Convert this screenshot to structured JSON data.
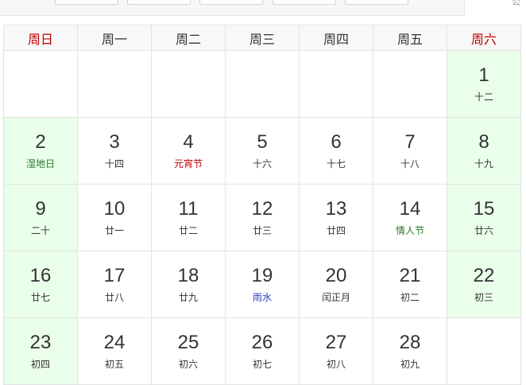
{
  "header": {
    "clipped_text": "公"
  },
  "weekdays": [
    "周日",
    "周一",
    "周二",
    "周三",
    "周四",
    "周五",
    "周六"
  ],
  "weeks": [
    [
      {
        "empty": true
      },
      {
        "empty": true
      },
      {
        "empty": true
      },
      {
        "empty": true
      },
      {
        "empty": true
      },
      {
        "empty": true
      },
      {
        "day": "1",
        "sub": "十二",
        "weekend": true
      }
    ],
    [
      {
        "day": "2",
        "sub": "湿地日",
        "weekend": true,
        "sub_color": "green"
      },
      {
        "day": "3",
        "sub": "十四"
      },
      {
        "day": "4",
        "sub": "元宵节",
        "sub_color": "red"
      },
      {
        "day": "5",
        "sub": "十六"
      },
      {
        "day": "6",
        "sub": "十七"
      },
      {
        "day": "7",
        "sub": "十八"
      },
      {
        "day": "8",
        "sub": "十九",
        "weekend": true
      }
    ],
    [
      {
        "day": "9",
        "sub": "二十",
        "weekend": true
      },
      {
        "day": "10",
        "sub": "廿一"
      },
      {
        "day": "11",
        "sub": "廿二"
      },
      {
        "day": "12",
        "sub": "廿三"
      },
      {
        "day": "13",
        "sub": "廿四"
      },
      {
        "day": "14",
        "sub": "情人节",
        "sub_color": "green"
      },
      {
        "day": "15",
        "sub": "廿六",
        "weekend": true
      }
    ],
    [
      {
        "day": "16",
        "sub": "廿七",
        "weekend": true
      },
      {
        "day": "17",
        "sub": "廿八"
      },
      {
        "day": "18",
        "sub": "廿九"
      },
      {
        "day": "19",
        "sub": "雨水",
        "sub_color": "blue"
      },
      {
        "day": "20",
        "sub": "闰正月"
      },
      {
        "day": "21",
        "sub": "初二"
      },
      {
        "day": "22",
        "sub": "初三",
        "weekend": true
      }
    ],
    [
      {
        "day": "23",
        "sub": "初四",
        "weekend": true
      },
      {
        "day": "24",
        "sub": "初五"
      },
      {
        "day": "25",
        "sub": "初六"
      },
      {
        "day": "26",
        "sub": "初七"
      },
      {
        "day": "27",
        "sub": "初八"
      },
      {
        "day": "28",
        "sub": "初九"
      },
      {
        "empty": true
      }
    ]
  ],
  "colors": {
    "weekend_bg": "#eaffea",
    "holiday_red": "#c00000",
    "festival_green": "#2a7a2a",
    "solar_term_blue": "#2040c0",
    "grid_line": "#e2e2e2"
  }
}
